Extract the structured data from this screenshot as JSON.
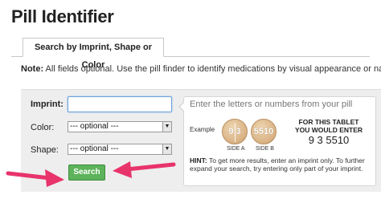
{
  "page": {
    "title": "Pill Identifier"
  },
  "tabs": [
    {
      "label": "Search by Imprint, Shape or Color"
    }
  ],
  "note": {
    "prefix": "Note:",
    "text": " All fields optional. Use the pill finder to identify medications by visual appearance or name."
  },
  "form": {
    "imprint_label": "Imprint:",
    "imprint_value": "",
    "color_label": "Color:",
    "color_selected": "--- optional ---",
    "shape_label": "Shape:",
    "shape_selected": "--- optional ---",
    "search_label": "Search"
  },
  "hint_panel": {
    "heading": "Enter the letters or numbers from your pill",
    "example_label": "Example",
    "pill_side_a_text": "9 3",
    "pill_side_b_text": "5510",
    "side_a_label": "SIDE A",
    "side_b_label": "SIDE B",
    "caption_line1": "FOR THIS TABLET",
    "caption_line2": "YOU WOULD ENTER",
    "imprint_example": "9 3 5510",
    "hint_prefix": "HINT:",
    "hint_text": " To get more results, enter an imprint only. To further expand your search, try entering only part of your imprint."
  },
  "colors": {
    "search_button": "#5db35a",
    "annotation_arrow": "#e8336b",
    "panel_bg": "#eeeeee"
  }
}
